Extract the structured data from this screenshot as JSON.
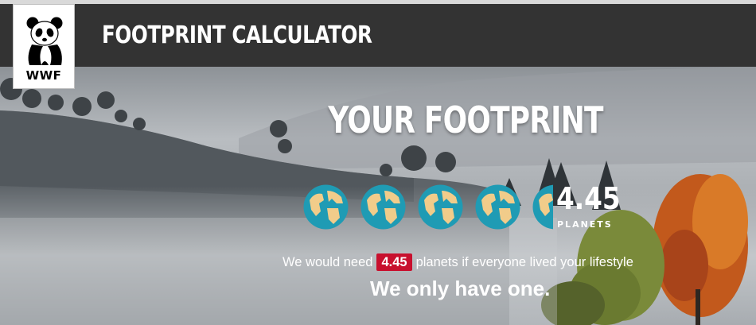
{
  "colors": {
    "header_bg": "#333333",
    "accent_red": "#c8102e",
    "earth_ocean": "#1f9bb4",
    "earth_land": "#f1cc8a"
  },
  "header": {
    "logo_text": "WWF",
    "title": "FOOTPRINT CALCULATOR",
    "logo_icon": "panda-icon"
  },
  "result": {
    "heading": "YOUR FOOTPRINT",
    "planet_value": "4.45",
    "planet_unit": "PLANETS",
    "planet_count": 4.45,
    "planet_icon": "earth-globe-icon",
    "need_prefix": "We would need",
    "need_value": "4.45",
    "need_suffix": "planets if everyone lived your lifestyle",
    "tagline": "We only have one."
  }
}
